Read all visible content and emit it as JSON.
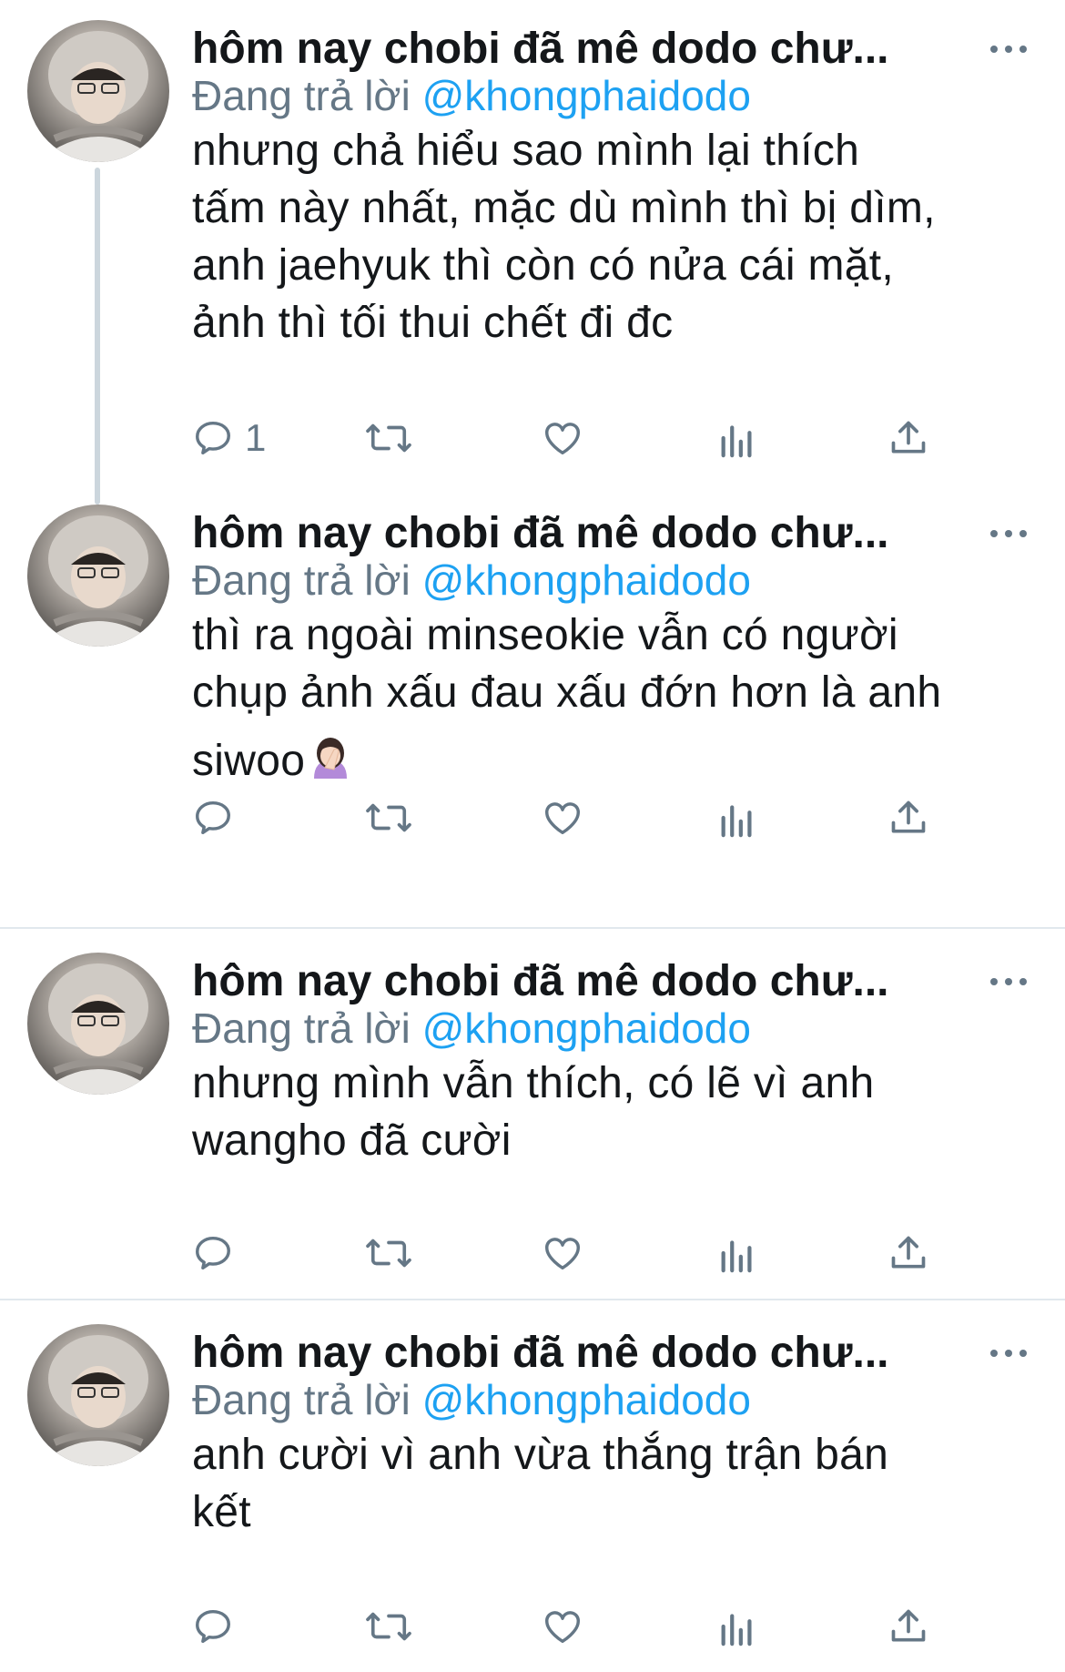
{
  "tweets": [
    {
      "name": "hôm nay chobi đã mê dodo chư...",
      "reply_prefix": "Đang trả lời",
      "reply_handle": "@khongphaidodo",
      "lines": [
        "nhưng chả hiểu sao mình lại thích",
        "tấm này nhất, mặc dù mình thì bị dìm,",
        "anh jaehyuk thì còn có nửa cái mặt,",
        "ảnh thì tối thui chết đi đc"
      ],
      "reply_count": "1"
    },
    {
      "name": "hôm nay chobi đã mê dodo chư...",
      "reply_prefix": "Đang trả lời",
      "reply_handle": "@khongphaidodo",
      "lines": [
        "thì ra ngoài minseokie vẫn có người",
        "chụp ảnh xấu đau xấu đớn hơn là anh",
        "siwoo"
      ],
      "reply_count": ""
    },
    {
      "name": "hôm nay chobi đã mê dodo chư...",
      "reply_prefix": "Đang trả lời",
      "reply_handle": "@khongphaidodo",
      "lines": [
        "nhưng mình vẫn thích, có lẽ vì anh",
        "wangho đã cười"
      ],
      "reply_count": ""
    },
    {
      "name": "hôm nay chobi đã mê dodo chư...",
      "reply_prefix": "Đang trả lời",
      "reply_handle": "@khongphaidodo",
      "lines": [
        "anh cười vì anh vừa thắng trận bán",
        "kết"
      ],
      "reply_count": ""
    }
  ],
  "icons": {
    "reply": "speech-bubble-icon",
    "retweet": "retweet-arrows-icon",
    "like": "heart-icon",
    "analytics": "bar-chart-icon",
    "share": "share-upload-icon",
    "more": "three-dots-icon",
    "emoji": "woman-facepalming-emoji"
  },
  "colors": {
    "text": "#14171a",
    "secondary": "#657786",
    "link": "#1da1f2",
    "divider": "#e1e8ed",
    "thread_line": "#ccd6dd"
  }
}
